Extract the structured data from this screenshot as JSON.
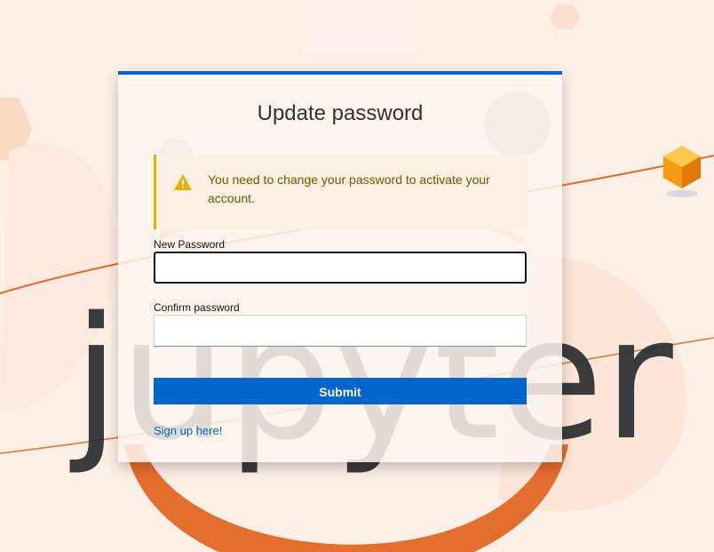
{
  "page": {
    "title": "Update password"
  },
  "alert": {
    "icon": "warning-triangle-icon",
    "message": "You need to change your password to activate your account."
  },
  "form": {
    "new_password_label": "New Password",
    "new_password_value": "",
    "confirm_password_label": "Confirm password",
    "confirm_password_value": "",
    "submit_label": "Submit"
  },
  "links": {
    "signup_label": "Sign up here!"
  },
  "colors": {
    "primary": "#0066cc",
    "warning": "#f0ab00",
    "background": "#fcefe6",
    "jupyter_orange": "#e46e2e"
  }
}
